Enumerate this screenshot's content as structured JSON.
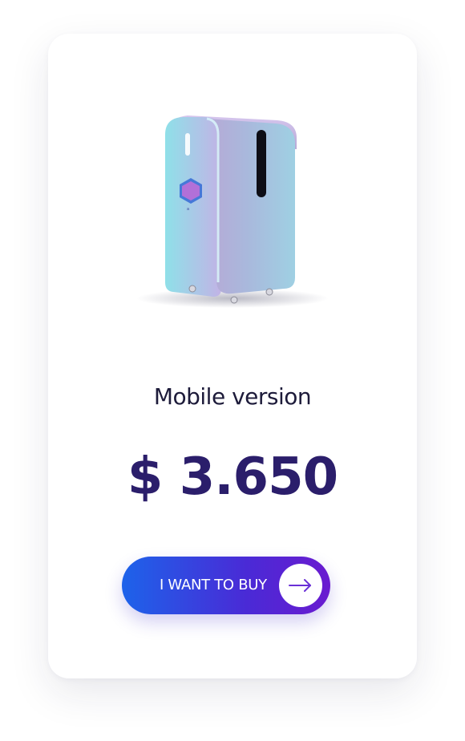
{
  "product": {
    "title": "Mobile version",
    "price": "$ 3.650",
    "image_icon": "photo-booth-kiosk"
  },
  "cta": {
    "label": "I WANT TO BUY",
    "icon": "arrow-right-icon"
  },
  "colors": {
    "title": "#1d1b3a",
    "price": "#2b1e6b",
    "button_start": "#1d63ea",
    "button_end": "#6a1bd0",
    "arrow": "#6a2fd6"
  }
}
